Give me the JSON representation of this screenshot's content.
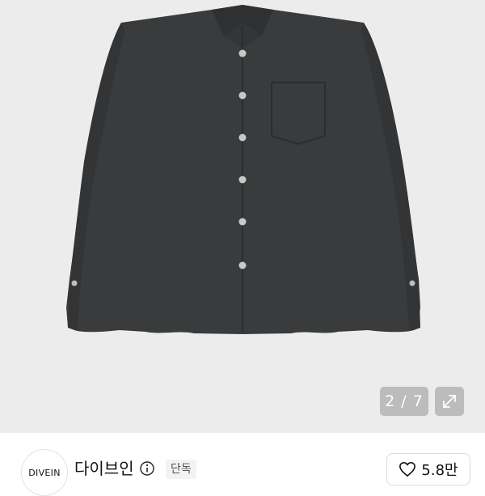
{
  "product_image": {
    "alt": "dark charcoal long-sleeve button-down shirt",
    "pager": "2 / 7"
  },
  "icons": {
    "expand": "expand-arrows-icon",
    "info": "info-icon",
    "heart": "heart-icon"
  },
  "brand": {
    "logo_text": "DIVEIN",
    "name": "다이브인",
    "badge": "단독"
  },
  "like": {
    "count": "5.8만"
  },
  "colors": {
    "image_bg": "#ececec",
    "shirt": "#3a3b3c",
    "button": "#c9c9c9"
  }
}
